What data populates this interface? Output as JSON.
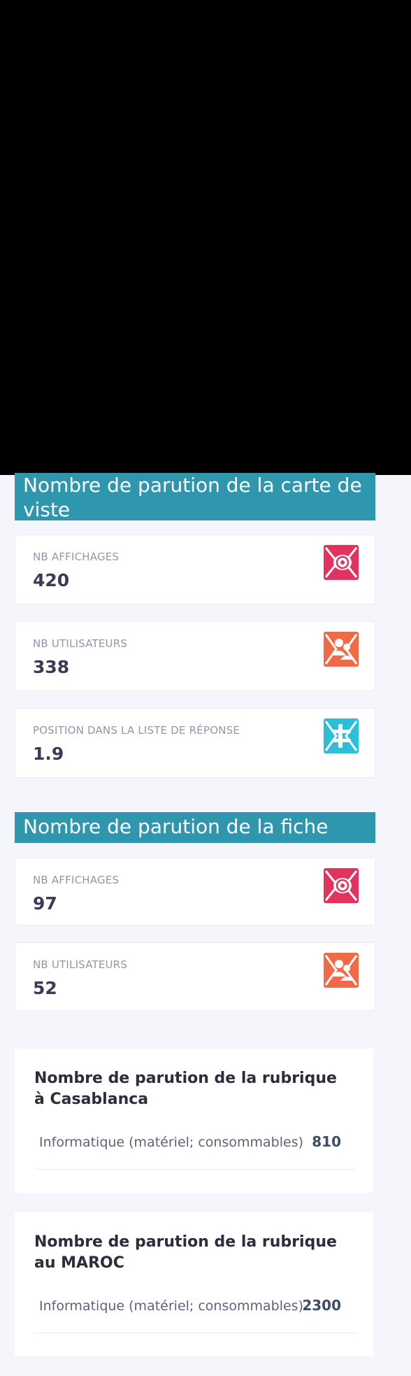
{
  "sections": {
    "carte": {
      "title": "Nombre de parution de la carte de viste",
      "stats": [
        {
          "label": "NB AFFICHAGES",
          "value": "420",
          "icon": "eye-icon"
        },
        {
          "label": "NB UTILISATEURS",
          "value": "338",
          "icon": "users-icon"
        },
        {
          "label": "POSITION DANS LA LISTE DE RÉPONSE",
          "value": "1.9",
          "icon": "list-position-icon"
        }
      ]
    },
    "fiche": {
      "title": "Nombre de parution de la fiche",
      "stats": [
        {
          "label": "NB AFFICHAGES",
          "value": "97",
          "icon": "eye-icon"
        },
        {
          "label": "NB UTILISATEURS",
          "value": "52",
          "icon": "users-icon"
        }
      ]
    }
  },
  "rubriques": [
    {
      "title": "Nombre de parution de la rubrique à Casablanca",
      "rows": [
        {
          "name": "Informatique (matériel; consommables)",
          "count": "810"
        }
      ]
    },
    {
      "title": "Nombre de parution de la rubrique au MAROC",
      "rows": [
        {
          "name": "Informatique (matériel; consommables)",
          "count": "2300"
        }
      ]
    }
  ],
  "colors": {
    "header": "#2e97ad",
    "eye_icon": "#e2325e",
    "users_icon": "#f26a45",
    "list_icon": "#2cbfd6",
    "background": "#f5f6fb"
  }
}
